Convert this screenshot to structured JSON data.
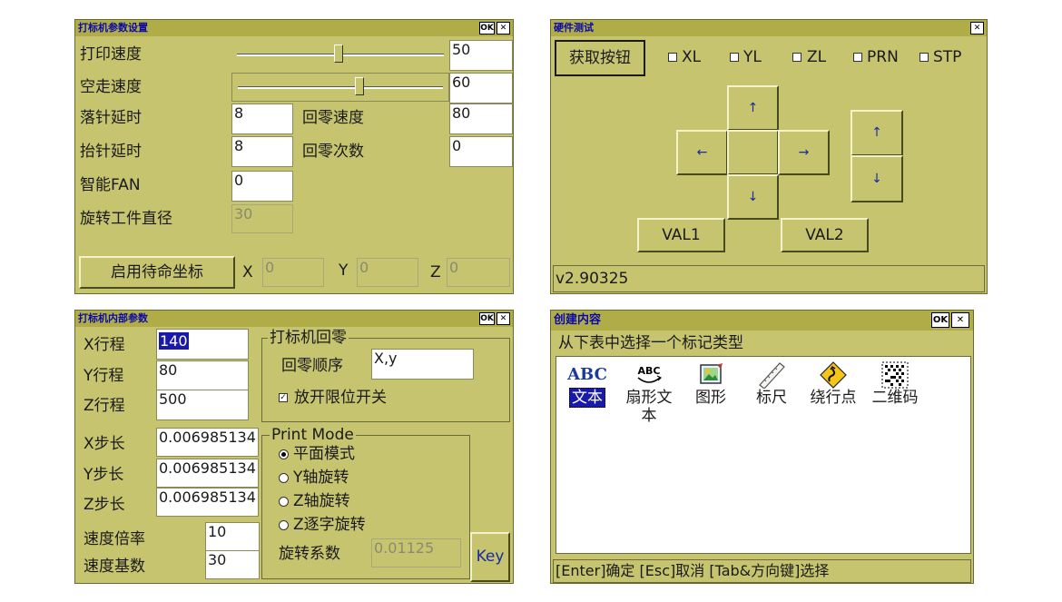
{
  "win1": {
    "title": "打标机参数设置",
    "ok": "OK",
    "close": "✕",
    "print_speed_label": "打印速度",
    "print_speed_value": "50",
    "print_speed_level": 0.5,
    "idle_speed_label": "空走速度",
    "idle_speed_value": "60",
    "idle_speed_level": 0.6,
    "needle_down_label": "落针延时",
    "needle_down_value": "8",
    "home_speed_label": "回零速度",
    "home_speed_value": "80",
    "needle_up_label": "抬针延时",
    "needle_up_value": "8",
    "home_count_label": "回零次数",
    "home_count_value": "0",
    "fan_label": "智能FAN",
    "fan_value": "0",
    "rot_diam_label": "旋转工件直径",
    "rot_diam_value": "30",
    "standby_button": "启用待命坐标",
    "x_label": "X",
    "x_value": "0",
    "y_label": "Y",
    "y_value": "0",
    "z_label": "Z",
    "z_value": "0"
  },
  "win2": {
    "title": "硬件测试",
    "close": "✕",
    "get_button": "获取按钮",
    "checks": [
      "XL",
      "YL",
      "ZL",
      "PRN",
      "STP"
    ],
    "up": "↑",
    "down": "↓",
    "left": "←",
    "right": "→",
    "val1": "VAL1",
    "val2": "VAL2",
    "version": "v2.90325"
  },
  "win3": {
    "title": "打标机内部参数",
    "ok": "OK",
    "close": "✕",
    "x_travel_label": "X行程",
    "x_travel_value": "140",
    "y_travel_label": "Y行程",
    "y_travel_value": "80",
    "z_travel_label": "Z行程",
    "z_travel_value": "500",
    "x_step_label": "X步长",
    "x_step_value": "0.006985134",
    "y_step_label": "Y步长",
    "y_step_value": "0.006985134",
    "z_step_label": "Z步长",
    "z_step_value": "0.006985134",
    "speed_mult_label": "速度倍率",
    "speed_mult_value": "10",
    "speed_base_label": "速度基数",
    "speed_base_value": "30",
    "home_group": "打标机回零",
    "home_order_label": "回零顺序",
    "home_order_value": "X,y",
    "limit_switch_label": "放开限位开关",
    "print_mode_group": "Print Mode",
    "modes": [
      "平面模式",
      "Y轴旋转",
      "Z轴旋转",
      "Z逐字旋转"
    ],
    "rot_coef_label": "旋转系数",
    "rot_coef_value": "0.01125",
    "key_button": "Key"
  },
  "win4": {
    "title": "创建内容",
    "ok": "OK",
    "close": "✕",
    "prompt": "从下表中选择一个标记类型",
    "items": [
      {
        "icon": "abc-text-icon",
        "label": "文本"
      },
      {
        "icon": "arc-text-icon",
        "label": "扇形文本"
      },
      {
        "icon": "picture-icon",
        "label": "图形"
      },
      {
        "icon": "ruler-icon",
        "label": "标尺"
      },
      {
        "icon": "winding-road-icon",
        "label": "绕行点"
      },
      {
        "icon": "qr-code-icon",
        "label": "二维码"
      }
    ],
    "abc_glyph": "ABC",
    "arc_glyph": "ABC",
    "status": "[Enter]确定 [Esc]取消 [Tab&方向键]选择"
  }
}
